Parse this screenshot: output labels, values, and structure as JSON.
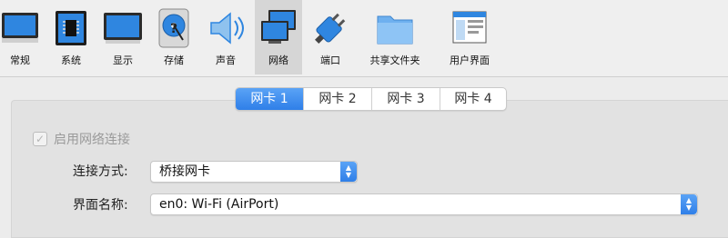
{
  "toolbar": {
    "items": [
      {
        "label": "常规",
        "icon": "monitor-general-icon"
      },
      {
        "label": "系统",
        "icon": "chip-system-icon"
      },
      {
        "label": "显示",
        "icon": "display-monitor-icon"
      },
      {
        "label": "存储",
        "icon": "disk-storage-icon"
      },
      {
        "label": "声音",
        "icon": "speaker-audio-icon"
      },
      {
        "label": "网络",
        "icon": "network-icon"
      },
      {
        "label": "端口",
        "icon": "port-plug-icon"
      },
      {
        "label": "共享文件夹",
        "icon": "folder-icon"
      },
      {
        "label": "用户界面",
        "icon": "window-ui-icon"
      }
    ],
    "selected": "网络"
  },
  "tabs": [
    "网卡 1",
    "网卡 2",
    "网卡 3",
    "网卡 4"
  ],
  "active_tab": "网卡 1",
  "enable_network": {
    "label": "启用网络连接",
    "checked": true
  },
  "attached_to": {
    "label": "连接方式:",
    "value": "桥接网卡"
  },
  "interface_name": {
    "label": "界面名称:",
    "value": "en0: Wi-Fi (AirPort)"
  },
  "colors": {
    "accent": "#2f7fe8",
    "background": "#ececec",
    "panel": "#e2e2e2"
  }
}
